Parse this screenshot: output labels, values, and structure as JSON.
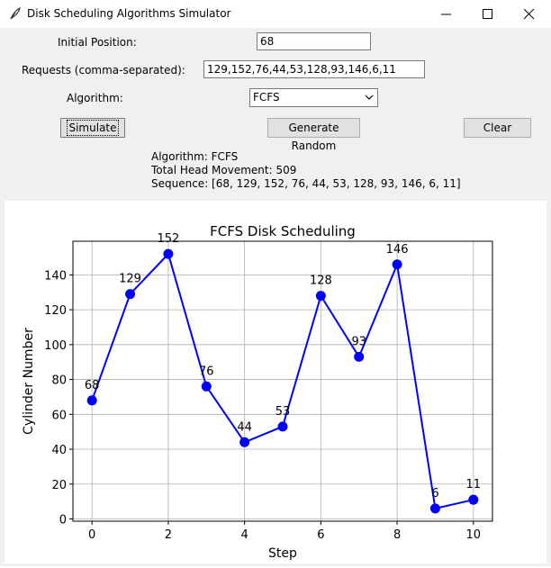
{
  "window": {
    "title": "Disk Scheduling Algorithms Simulator",
    "controls": [
      "minimize",
      "maximize",
      "close"
    ]
  },
  "form": {
    "initial_position_label": "Initial Position:",
    "initial_position_value": "68",
    "requests_label": "Requests (comma-separated):",
    "requests_value": "129,152,76,44,53,128,93,146,6,11",
    "algorithm_label": "Algorithm:",
    "algorithm_value": "FCFS"
  },
  "buttons": {
    "simulate": "Simulate",
    "generate_random": "Generate Random",
    "clear": "Clear"
  },
  "results": {
    "algorithm_line": "Algorithm: FCFS",
    "movement_line": "Total Head Movement: 509",
    "sequence_line": "Sequence: [68, 129, 152, 76, 44, 53, 128, 93, 146, 6, 11]"
  },
  "chart_data": {
    "type": "line",
    "title": "FCFS Disk Scheduling",
    "xlabel": "Step",
    "ylabel": "Cylinder Number",
    "x": [
      0,
      1,
      2,
      3,
      4,
      5,
      6,
      7,
      8,
      9,
      10
    ],
    "values": [
      68,
      129,
      152,
      76,
      44,
      53,
      128,
      93,
      146,
      6,
      11
    ],
    "xlim": [
      -0.5,
      10.5
    ],
    "ylim": [
      -1.3,
      159.3
    ],
    "xticks": [
      0,
      2,
      4,
      6,
      8,
      10
    ],
    "yticks": [
      0,
      20,
      40,
      60,
      80,
      100,
      120,
      140
    ],
    "grid": true,
    "color": "#0000ff",
    "data_labels": true
  }
}
